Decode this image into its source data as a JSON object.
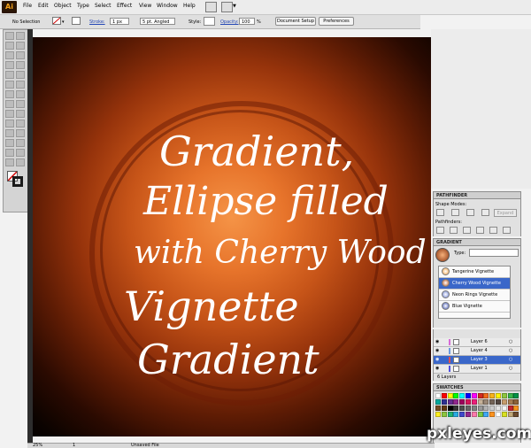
{
  "app": {
    "logo": "Ai"
  },
  "menu": [
    "File",
    "Edit",
    "Object",
    "Type",
    "Select",
    "Effect",
    "View",
    "Window",
    "Help"
  ],
  "control_bar": {
    "selection": "No Selection",
    "stroke_label": "Stroke:",
    "stroke_value": "1 px",
    "brush": "5 pt. Angled",
    "style_label": "Style:",
    "opacity_label": "Opacity:",
    "opacity_value": "100",
    "opacity_unit": "%",
    "document_setup": "Document Setup",
    "preferences": "Preferences"
  },
  "canvas_text": {
    "line1": "Gradient,",
    "line2": "Ellipse filled",
    "line3": "with Cherry Wood",
    "line4": "Vignette",
    "line5": "Gradient"
  },
  "status_bar": {
    "zoom": "25%",
    "page": "1",
    "status": "Unsaved File"
  },
  "pathfinder": {
    "title": "PATHFINDER",
    "shape_modes": "Shape Modes:",
    "expand": "Expand",
    "pathfinders": "Pathfinders:"
  },
  "gradient": {
    "title": "GRADIENT",
    "type_label": "Type:",
    "items": [
      {
        "label": "Tangerine Vignette",
        "selected": false,
        "color": "#f0a040"
      },
      {
        "label": "Cherry Wood Vignette",
        "selected": true,
        "color": "#b5501c"
      },
      {
        "label": "Neon Rings Vignette",
        "selected": false,
        "color": "#6a7fd0"
      },
      {
        "label": "Blue Vignette",
        "selected": false,
        "color": "#3a4fb0"
      }
    ]
  },
  "layers": {
    "items": [
      {
        "label": "Layer 6",
        "selected": false,
        "color": "#d86bd8"
      },
      {
        "label": "Layer 4",
        "selected": false,
        "color": "#6a9ae0"
      },
      {
        "label": "Layer 3",
        "selected": true,
        "color": "#e05050"
      },
      {
        "label": "Layer 1",
        "selected": false,
        "color": "#5050e0"
      }
    ],
    "count": "6 Layers"
  },
  "swatches": {
    "title": "SWATCHES"
  },
  "watermark": "pxleyes.com",
  "colors": {
    "canvas_center": "#f59447",
    "canvas_edge": "#050100",
    "selection_blue": "#3a67c9"
  }
}
